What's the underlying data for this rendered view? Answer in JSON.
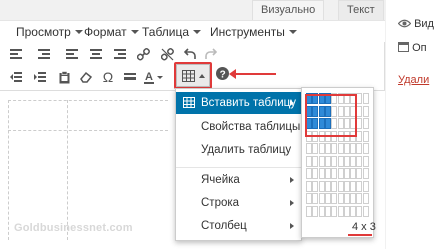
{
  "tabs": {
    "visual": "Визуально",
    "text": "Текст"
  },
  "menubar": [
    "Просмотр",
    "Формат",
    "Таблица",
    "Инструменты"
  ],
  "dropdown": {
    "items": [
      {
        "label": "Вставить таблицу",
        "submenu": true,
        "active": true
      },
      {
        "label": "Свойства таблицы",
        "submenu": false
      },
      {
        "label": "Удалить таблицу",
        "submenu": false
      },
      {
        "label": "Ячейка",
        "submenu": true
      },
      {
        "label": "Строка",
        "submenu": true
      },
      {
        "label": "Столбец",
        "submenu": true
      }
    ]
  },
  "grid": {
    "cols": 10,
    "rows": 10,
    "selected_cols": 4,
    "selected_rows": 3,
    "label": "4 x 3"
  },
  "sidebar": {
    "view": "Вид",
    "options": "Оп",
    "delete": "Удали"
  },
  "watermark": "Goldbusinessnet.com",
  "colors": {
    "accent": "#0073aa",
    "highlight": "#e03a3a",
    "grid_on": "#2f8ad8"
  }
}
